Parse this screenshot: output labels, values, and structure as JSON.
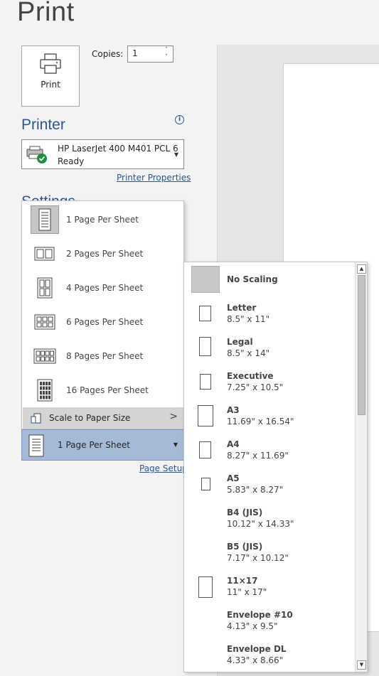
{
  "page": {
    "title": "Print"
  },
  "print_button": {
    "label": "Print",
    "icon": "printer-icon"
  },
  "copies": {
    "label": "Copies:",
    "value": "1",
    "spin_up": "˄",
    "spin_down": "˅"
  },
  "printer": {
    "section_title": "Printer",
    "info_icon": "i",
    "name": "HP LaserJet 400 M401 PCL 6",
    "status": "Ready",
    "caret": "▼",
    "properties_link": "Printer Properties"
  },
  "settings": {
    "section_title": "Settings"
  },
  "pages_per_sheet_menu": {
    "items": [
      {
        "label": "1 Page Per Sheet",
        "selected": true
      },
      {
        "label": "2 Pages Per Sheet"
      },
      {
        "label": "4 Pages Per Sheet"
      },
      {
        "label": "6 Pages Per Sheet"
      },
      {
        "label": "8 Pages Per Sheet"
      },
      {
        "label": "16 Pages Per Sheet"
      }
    ],
    "scale_item": {
      "label": "Scale to Paper Size",
      "arrow": ">"
    }
  },
  "pages_per_sheet_select": {
    "value": "1 Page Per Sheet",
    "caret": "▼"
  },
  "page_setup_link": "Page Setup",
  "paper_size_menu": {
    "no_scaling": "No Scaling",
    "items": [
      {
        "name": "Letter",
        "dims": "8.5\" x 11\""
      },
      {
        "name": "Legal",
        "dims": "8.5\" x 14\""
      },
      {
        "name": "Executive",
        "dims": "7.25\" x 10.5\""
      },
      {
        "name": "A3",
        "dims": "11.69\" x 16.54\""
      },
      {
        "name": "A4",
        "dims": "8.27\" x 11.69\""
      },
      {
        "name": "A5",
        "dims": "5.83\" x 8.27\""
      },
      {
        "name": "B4 (JIS)",
        "dims": "10.12\" x 14.33\""
      },
      {
        "name": "B5 (JIS)",
        "dims": "7.17\" x 10.12\""
      },
      {
        "name": "11×17",
        "dims": "11\" x 17\""
      },
      {
        "name": "Envelope #10",
        "dims": "4.13\" x 9.5\""
      },
      {
        "name": "Envelope DL",
        "dims": "4.33\" x 8.66\""
      }
    ],
    "scroll_up": "▲",
    "scroll_down": "▼"
  },
  "colors": {
    "accent": "#2b579a",
    "selected_bg": "#a5bad7",
    "hover_bg": "#d4d4d4"
  }
}
